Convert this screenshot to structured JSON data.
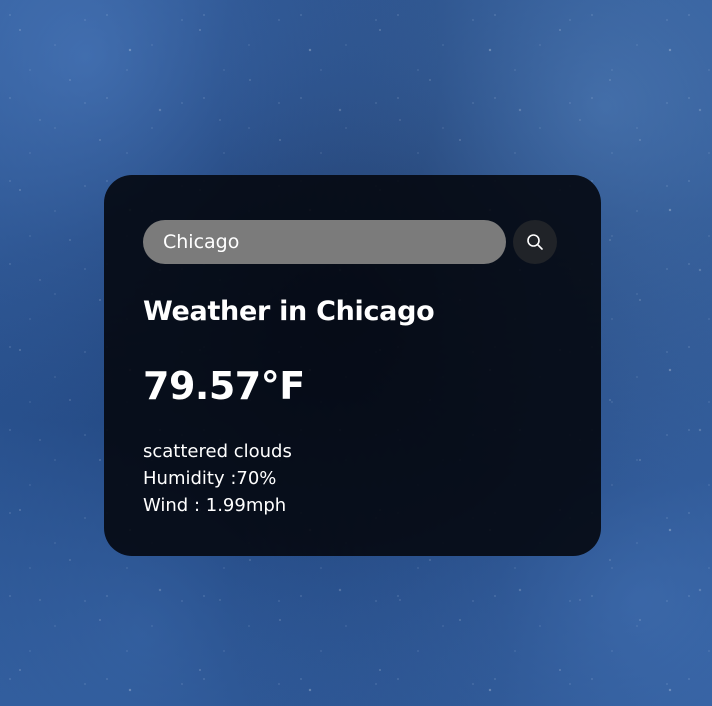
{
  "search": {
    "value": "Chicago",
    "placeholder": "Search",
    "button_icon": "search-icon"
  },
  "weather": {
    "title": "Weather in Chicago",
    "temperature": "79.57°F",
    "description": "scattered clouds",
    "humidity": "Humidity :70%",
    "wind": "Wind : 1.99mph"
  },
  "colors": {
    "card_background": "#05080f",
    "search_field": "#7b7b7b",
    "search_button": "#202328",
    "text": "#ffffff",
    "background": "#1b3d74"
  }
}
